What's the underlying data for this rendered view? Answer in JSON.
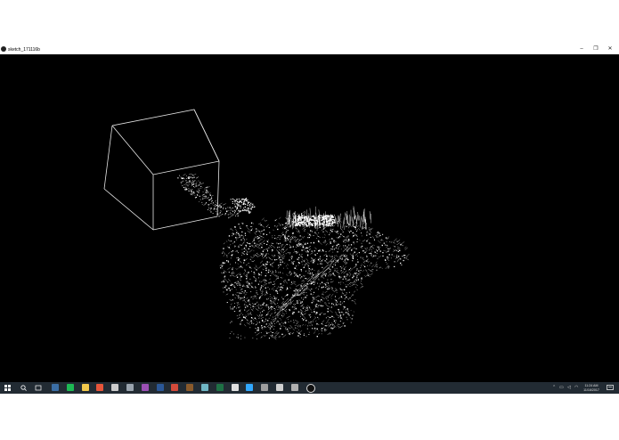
{
  "window": {
    "title": "sketch_171116b",
    "minimize_glyph": "–",
    "maximize_glyph": "❐",
    "close_glyph": "✕"
  },
  "taskbar": {
    "start_icon": "windows-start-icon",
    "search_icon": "search-icon",
    "taskview_icon": "task-view-icon",
    "apps": [
      {
        "name": "app-icon-1",
        "color": "#3b6ea5"
      },
      {
        "name": "spotify-icon",
        "color": "#1db954"
      },
      {
        "name": "file-explorer-icon",
        "color": "#f2c94c"
      },
      {
        "name": "chrome-icon",
        "color": "#e7553a"
      },
      {
        "name": "vpn-shield-icon",
        "color": "#cccccc"
      },
      {
        "name": "app-icon-6",
        "color": "#9aa4ae"
      },
      {
        "name": "onenote-icon",
        "color": "#9b4fb4"
      },
      {
        "name": "word-icon",
        "color": "#2b5797"
      },
      {
        "name": "app-icon-9",
        "color": "#d34a3a"
      },
      {
        "name": "app-icon-10",
        "color": "#8a5a2b"
      },
      {
        "name": "app-icon-11",
        "color": "#6fb6c5"
      },
      {
        "name": "excel-icon",
        "color": "#1e7145"
      },
      {
        "name": "app-icon-13",
        "color": "#e0e0e0"
      },
      {
        "name": "photoshop-icon",
        "color": "#31a8ff"
      },
      {
        "name": "settings-icon",
        "color": "#9e9e9e"
      },
      {
        "name": "app-icon-16",
        "color": "#cfcfcf"
      },
      {
        "name": "app-icon-17",
        "color": "#b0b0b0"
      },
      {
        "name": "processing-icon",
        "color": "#f5f5f5"
      }
    ],
    "clock_time": "11:24 AM",
    "clock_date": "11/16/2017"
  }
}
